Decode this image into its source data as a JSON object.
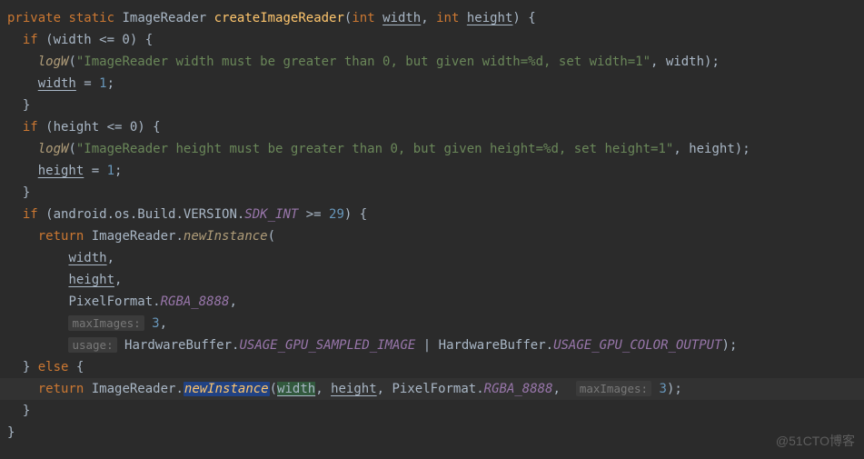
{
  "watermark": "@51CTO博客",
  "code": {
    "keywords": {
      "private": "private",
      "static": "static",
      "int": "int",
      "if": "if",
      "else": "else",
      "return": "return"
    },
    "methodName": "createImageReader",
    "returnType": "ImageReader",
    "params": {
      "width": "width",
      "height": "height"
    },
    "widthCheck": {
      "cond": "width <= 0",
      "logFn": "logW",
      "msg": "\"ImageReader width must be greater than 0, but given width=%d, set width=1\"",
      "arg": "width",
      "assignLhs": "width",
      "assignRhs": "1"
    },
    "heightCheck": {
      "cond": "height <= 0",
      "logFn": "logW",
      "msg": "\"ImageReader height must be greater than 0, but given height=%d, set height=1\"",
      "arg": "height",
      "assignLhs": "height",
      "assignRhs": "1"
    },
    "sdk": {
      "qualifier": "android.os.Build.VERSION.",
      "field": "SDK_INT",
      "op": " >= ",
      "val": "29"
    },
    "newInstanceCall": {
      "receiver": "ImageReader.",
      "method": "newInstance",
      "arg1": "width",
      "arg2": "height",
      "pixelFmtQualifier": "PixelFormat.",
      "pixelFmtField": "RGBA_8888",
      "hintMaxImages": "maxImages:",
      "maxImagesVal": "3",
      "hintUsage": "usage:",
      "hwBuf": "HardwareBuffer.",
      "usage1": "USAGE_GPU_SAMPLED_IMAGE",
      "or": " | ",
      "usage2": "USAGE_GPU_COLOR_OUTPUT"
    },
    "elseCall": {
      "receiver": "ImageReader.",
      "method": "newInstance",
      "arg1": "width",
      "arg2": "height",
      "pixelFmtQualifier": "PixelFormat.",
      "pixelFmtField": "RGBA_8888",
      "hintMaxImages": "maxImages:",
      "maxImagesVal": "3"
    }
  }
}
